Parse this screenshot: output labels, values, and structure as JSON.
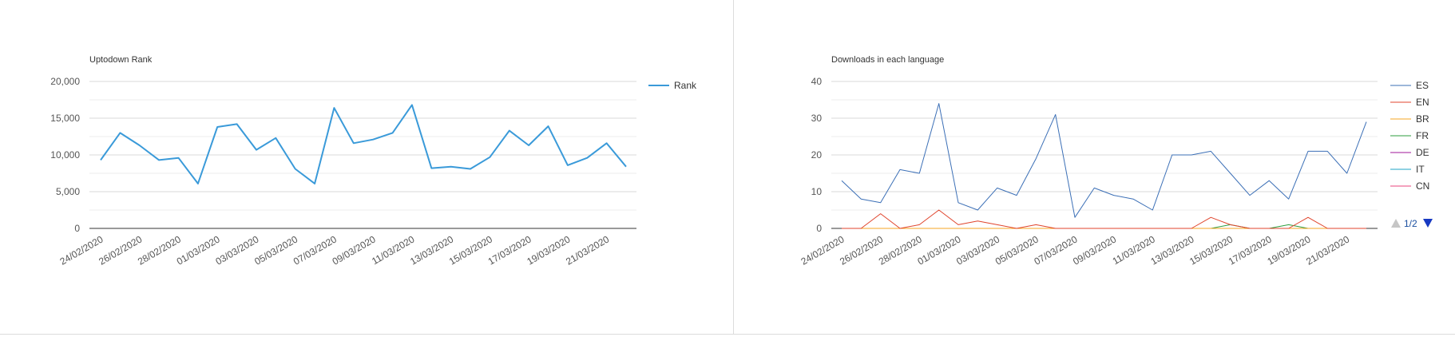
{
  "chart_data": [
    {
      "type": "line",
      "title": "Uptodown Rank",
      "x": [
        "24/02/2020",
        "25/02/2020",
        "26/02/2020",
        "27/02/2020",
        "28/02/2020",
        "29/02/2020",
        "01/03/2020",
        "02/03/2020",
        "03/03/2020",
        "04/03/2020",
        "05/03/2020",
        "06/03/2020",
        "07/03/2020",
        "08/03/2020",
        "09/03/2020",
        "10/03/2020",
        "11/03/2020",
        "12/03/2020",
        "13/03/2020",
        "14/03/2020",
        "15/03/2020",
        "16/03/2020",
        "17/03/2020",
        "18/03/2020",
        "19/03/2020",
        "20/03/2020",
        "21/03/2020",
        "22/03/2020"
      ],
      "xticks": [
        "24/02/2020",
        "26/02/2020",
        "28/02/2020",
        "01/03/2020",
        "03/03/2020",
        "05/03/2020",
        "07/03/2020",
        "09/03/2020",
        "11/03/2020",
        "13/03/2020",
        "15/03/2020",
        "17/03/2020",
        "19/03/2020",
        "21/03/2020"
      ],
      "series": [
        {
          "name": "Rank",
          "color": "#3a9ad9",
          "values": [
            9300,
            13000,
            11300,
            9300,
            9600,
            6100,
            13800,
            14200,
            10700,
            12300,
            8100,
            6100,
            16400,
            11600,
            12100,
            13000,
            16800,
            8200,
            8400,
            8100,
            9700,
            13300,
            11300,
            13900,
            8600,
            9600,
            11600,
            8400
          ]
        }
      ],
      "yticks": [
        "0",
        "5,000",
        "10,000",
        "15,000",
        "20,000"
      ],
      "ylim": [
        0,
        20000
      ],
      "grid": true,
      "legend_position": "right"
    },
    {
      "type": "line",
      "title": "Downloads in each language",
      "x": [
        "24/02/2020",
        "25/02/2020",
        "26/02/2020",
        "27/02/2020",
        "28/02/2020",
        "29/02/2020",
        "01/03/2020",
        "02/03/2020",
        "03/03/2020",
        "04/03/2020",
        "05/03/2020",
        "06/03/2020",
        "07/03/2020",
        "08/03/2020",
        "09/03/2020",
        "10/03/2020",
        "11/03/2020",
        "12/03/2020",
        "13/03/2020",
        "14/03/2020",
        "15/03/2020",
        "16/03/2020",
        "17/03/2020",
        "18/03/2020",
        "19/03/2020",
        "20/03/2020",
        "21/03/2020",
        "22/03/2020"
      ],
      "xticks": [
        "24/02/2020",
        "26/02/2020",
        "28/02/2020",
        "01/03/2020",
        "03/03/2020",
        "05/03/2020",
        "07/03/2020",
        "09/03/2020",
        "11/03/2020",
        "13/03/2020",
        "15/03/2020",
        "17/03/2020",
        "19/03/2020",
        "21/03/2020"
      ],
      "series": [
        {
          "name": "ES",
          "color": "#3b6fb6",
          "values": [
            13,
            8,
            7,
            16,
            15,
            34,
            7,
            5,
            11,
            9,
            19,
            31,
            3,
            11,
            9,
            8,
            5,
            20,
            20,
            21,
            15,
            9,
            13,
            8,
            21,
            21,
            15,
            29
          ]
        },
        {
          "name": "EN",
          "color": "#e0442c",
          "values": [
            0,
            0,
            4,
            0,
            1,
            5,
            1,
            2,
            1,
            0,
            1,
            0,
            0,
            0,
            0,
            0,
            0,
            0,
            0,
            3,
            1,
            0,
            0,
            0,
            3,
            0,
            0,
            0
          ]
        },
        {
          "name": "BR",
          "color": "#f5a623",
          "values": [
            0,
            0,
            0,
            0,
            0,
            0,
            0,
            0,
            0,
            0,
            0,
            0,
            0,
            0,
            0,
            0,
            0,
            0,
            0,
            0,
            0,
            0,
            0,
            0,
            0,
            0,
            0,
            0
          ]
        },
        {
          "name": "FR",
          "color": "#2e9e3e",
          "values": [
            0,
            0,
            0,
            0,
            0,
            0,
            0,
            0,
            0,
            0,
            0,
            0,
            0,
            0,
            0,
            0,
            0,
            0,
            0,
            0,
            1,
            0,
            0,
            1,
            0,
            0,
            0,
            0
          ]
        },
        {
          "name": "DE",
          "color": "#a0179a",
          "values": [
            0,
            0,
            0,
            0,
            0,
            0,
            0,
            0,
            0,
            0,
            0,
            0,
            0,
            0,
            0,
            0,
            0,
            0,
            0,
            0,
            0,
            0,
            0,
            0,
            0,
            0,
            0,
            0
          ]
        },
        {
          "name": "IT",
          "color": "#1fa3c4",
          "values": [
            0,
            0,
            0,
            0,
            0,
            0,
            0,
            0,
            0,
            0,
            0,
            0,
            0,
            0,
            0,
            0,
            0,
            0,
            0,
            0,
            0,
            0,
            0,
            0,
            0,
            0,
            0,
            0
          ]
        },
        {
          "name": "CN",
          "color": "#e8467c",
          "values": [
            0,
            0,
            0,
            0,
            0,
            0,
            0,
            0,
            0,
            0,
            0,
            0,
            0,
            0,
            0,
            0,
            0,
            0,
            0,
            0,
            0,
            0,
            0,
            0,
            0,
            0,
            0,
            0
          ]
        }
      ],
      "yticks": [
        "0",
        "10",
        "20",
        "30",
        "40"
      ],
      "ylim": [
        0,
        40
      ],
      "grid": true,
      "legend_position": "right",
      "legend_pager": "1/2"
    }
  ]
}
